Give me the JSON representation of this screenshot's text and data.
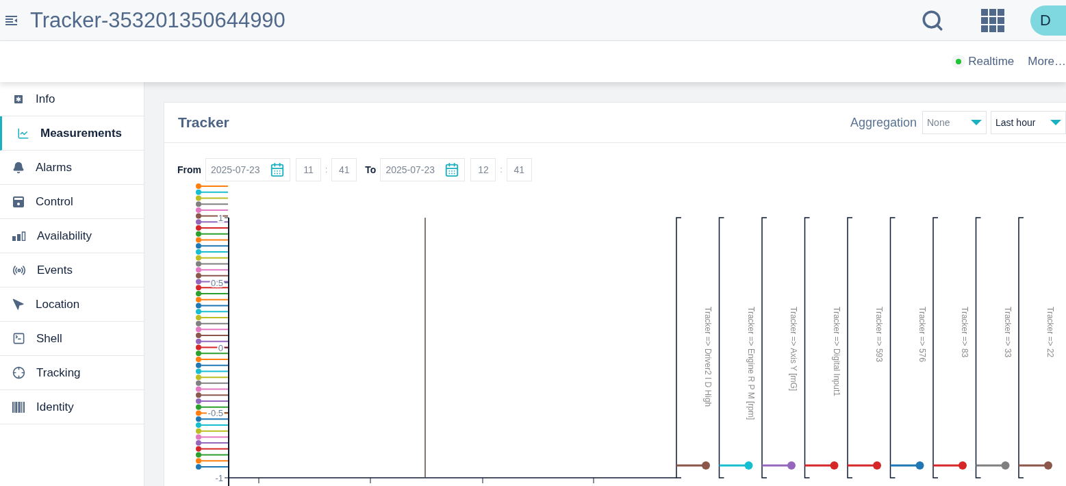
{
  "header": {
    "title": "Tracker-353201350644990",
    "avatar": "D"
  },
  "action_bar": {
    "realtime": {
      "label": "Realtime",
      "on": true
    },
    "more": "More…"
  },
  "sidebar": {
    "items": [
      {
        "label": "Info",
        "selected": false
      },
      {
        "label": "Measurements",
        "selected": true
      },
      {
        "label": "Alarms",
        "selected": false
      },
      {
        "label": "Control",
        "selected": false
      },
      {
        "label": "Availability",
        "selected": false
      },
      {
        "label": "Events",
        "selected": false
      },
      {
        "label": "Location",
        "selected": false
      },
      {
        "label": "Shell",
        "selected": false
      },
      {
        "label": "Tracking",
        "selected": false
      },
      {
        "label": "Identity",
        "selected": false
      }
    ]
  },
  "card": {
    "title": "Tracker",
    "aggregation_label": "Aggregation",
    "aggregation": "None",
    "interval": "Last hour",
    "from": {
      "label": "From",
      "date": "2025-07-23",
      "hour": "11",
      "separator": ":",
      "minute": "41"
    },
    "to": {
      "label": "To",
      "date": "2025-07-23",
      "hour": "12",
      "separator": ":",
      "minute": "41"
    }
  },
  "chart": {
    "y_ticks": [
      "1",
      "0.5",
      "0",
      "-0.5",
      "-1"
    ],
    "legend_markers": [
      {
        "color": "#ff7f0e"
      },
      {
        "color": "#17becf"
      },
      {
        "color": "#bcbd22"
      },
      {
        "color": "#7f7f7f"
      },
      {
        "color": "#e377c2"
      },
      {
        "color": "#8c564b"
      },
      {
        "color": "#9467bd"
      },
      {
        "color": "#d62728"
      },
      {
        "color": "#2ca02c"
      },
      {
        "color": "#ff7f0e"
      },
      {
        "color": "#1f77b4"
      },
      {
        "color": "#17becf"
      },
      {
        "color": "#bcbd22"
      },
      {
        "color": "#7f7f7f"
      },
      {
        "color": "#e377c2"
      },
      {
        "color": "#8c564b"
      },
      {
        "color": "#9467bd"
      },
      {
        "color": "#d62728"
      },
      {
        "color": "#2ca02c"
      },
      {
        "color": "#ff7f0e"
      },
      {
        "color": "#1f77b4"
      },
      {
        "color": "#17becf"
      },
      {
        "color": "#bcbd22"
      },
      {
        "color": "#7f7f7f"
      },
      {
        "color": "#e377c2"
      },
      {
        "color": "#8c564b"
      },
      {
        "color": "#9467bd"
      },
      {
        "color": "#d62728"
      },
      {
        "color": "#2ca02c"
      },
      {
        "color": "#ff7f0e"
      },
      {
        "color": "#1f77b4"
      },
      {
        "color": "#17becf"
      },
      {
        "color": "#bcbd22"
      },
      {
        "color": "#7f7f7f"
      },
      {
        "color": "#e377c2"
      },
      {
        "color": "#8c564b"
      },
      {
        "color": "#9467bd"
      },
      {
        "color": "#2ca02c"
      },
      {
        "color": "#ff7f0e"
      },
      {
        "color": "#1f77b4"
      },
      {
        "color": "#17becf"
      },
      {
        "color": "#bcbd22"
      },
      {
        "color": "#e377c2"
      },
      {
        "color": "#9467bd"
      },
      {
        "color": "#d62728"
      },
      {
        "color": "#2ca02c"
      },
      {
        "color": "#ff7f0e"
      },
      {
        "color": "#1f77b4"
      }
    ],
    "axes": [
      {
        "label": "Tracker => Driver2 I D High",
        "color": "#8c564b"
      },
      {
        "label": "Tracker => Engine R P M [rpm]",
        "color": "#17becf"
      },
      {
        "label": "Tracker => Axis Y [mG]",
        "color": "#9467bd"
      },
      {
        "label": "Tracker => Digital Input1",
        "color": "#d62728"
      },
      {
        "label": "Tracker => 593",
        "color": "#d62728"
      },
      {
        "label": "Tracker => 576",
        "color": "#1f77b4"
      },
      {
        "label": "Tracker => 83",
        "color": "#d62728"
      },
      {
        "label": "Tracker => 33",
        "color": "#7f7f7f"
      },
      {
        "label": "Tracker => 22",
        "color": "#8c564b"
      }
    ]
  }
}
